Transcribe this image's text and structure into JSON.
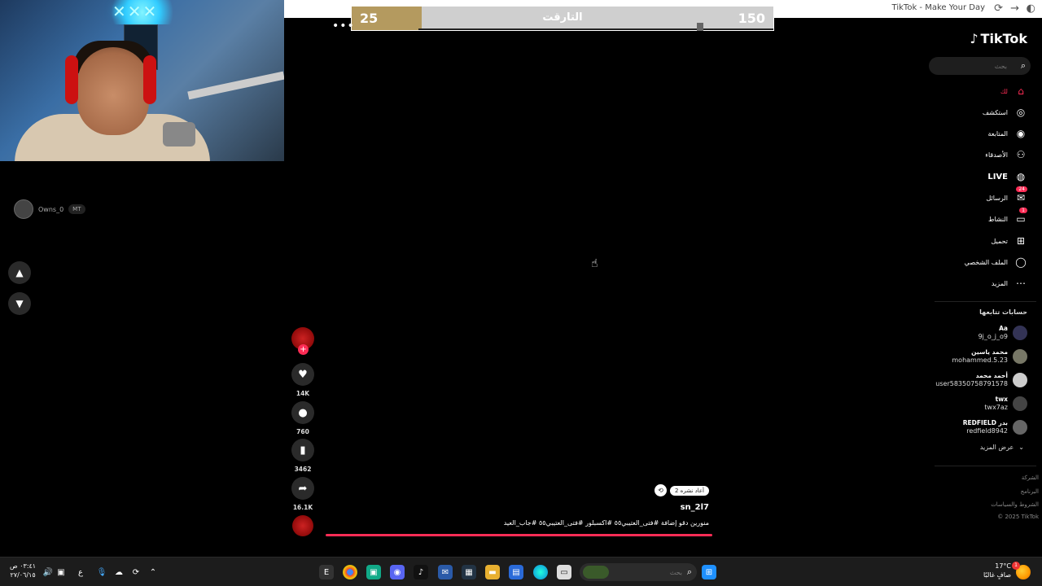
{
  "window": {
    "title": "TikTok - Make Your Day"
  },
  "poll": {
    "left_value": "25",
    "right_value": "150",
    "label": "التارقت",
    "progress": 0.1667,
    "fill_color": "#b49a5f"
  },
  "streamer": {
    "name": "Owns_0",
    "tag": "MT"
  },
  "video": {
    "likes": "14K",
    "comments": "760",
    "saves": "3462",
    "shares": "16.1K",
    "repost_label": "2 أعاد نشره",
    "author": "sn_2l7",
    "caption": "منورين دقو إضافة #فتى_العتيبي٥٥ #اكسبلور #فتى_العتيبي٥٥ #جاب_العيد",
    "progress_color": "#fe2c55",
    "icons": {
      "like": "heart-icon",
      "comment": "comment-icon",
      "save": "bookmark-icon",
      "share": "share-icon",
      "follow": "plus-icon"
    }
  },
  "sidebar": {
    "logo": "TikTok",
    "search_placeholder": "بحث",
    "nav": [
      {
        "label": "لك",
        "icon": "home-icon",
        "active": true
      },
      {
        "label": "استكشف",
        "icon": "compass-icon"
      },
      {
        "label": "المتابعة",
        "icon": "following-icon"
      },
      {
        "label": "الأصدقاء",
        "icon": "friends-icon"
      },
      {
        "label": "LIVE",
        "icon": "live-icon"
      },
      {
        "label": "الرسائل",
        "icon": "messages-icon",
        "badge": "24"
      },
      {
        "label": "النشاط",
        "icon": "activity-icon",
        "badge": "1"
      },
      {
        "label": "تحميل",
        "icon": "upload-icon"
      },
      {
        "label": "الملف الشخصي",
        "icon": "profile-icon"
      },
      {
        "label": "المزيد",
        "icon": "more-icon"
      }
    ],
    "following_title": "حسابات تتابعها",
    "accounts": [
      {
        "display": "Aa",
        "username": "9j_o_j_o9"
      },
      {
        "display": "محمد ياسين",
        "username": "mohammed.5.23"
      },
      {
        "display": "أحمد محمد",
        "username": "user58350758791578"
      },
      {
        "display": "twx",
        "username": "twx7az"
      },
      {
        "display": "REDFIELD بدر",
        "username": "redfield8942"
      }
    ],
    "see_more": "عرض المزيد",
    "footer": [
      "الشركة",
      "البرنامج",
      "الشروط والسياسات",
      "© 2025 TikTok"
    ]
  },
  "taskbar": {
    "time": "٠٣:٤١ ص",
    "date": "٢٧/٠٦/١٥",
    "lang": "ع",
    "search_placeholder": "بحث",
    "weather_temp": "17°C",
    "weather_desc": "صافٍ غالبًا",
    "weather_badge": "1"
  },
  "accent_color": "#fe2c55"
}
